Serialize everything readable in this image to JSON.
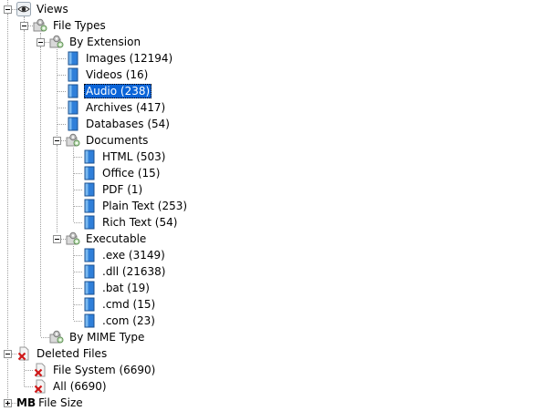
{
  "tree": {
    "nodes": [
      {
        "id": "views",
        "label": "Views",
        "icon": "eye-icon",
        "expanded": true
      },
      {
        "id": "file-types",
        "label": "File Types",
        "icon": "folder-gears-icon",
        "expanded": true
      },
      {
        "id": "by-extension",
        "label": "By Extension",
        "icon": "folder-gears-icon",
        "expanded": true
      },
      {
        "id": "images",
        "label": "Images (12194)",
        "icon": "file-icon"
      },
      {
        "id": "videos",
        "label": "Videos (16)",
        "icon": "file-icon"
      },
      {
        "id": "audio",
        "label": "Audio (238)",
        "icon": "file-icon",
        "selected": true
      },
      {
        "id": "archives",
        "label": "Archives (417)",
        "icon": "file-icon"
      },
      {
        "id": "databases",
        "label": "Databases (54)",
        "icon": "file-icon"
      },
      {
        "id": "documents",
        "label": "Documents",
        "icon": "folder-gears-icon",
        "expanded": true
      },
      {
        "id": "html",
        "label": "HTML (503)",
        "icon": "file-icon"
      },
      {
        "id": "office",
        "label": "Office (15)",
        "icon": "file-icon"
      },
      {
        "id": "pdf",
        "label": "PDF (1)",
        "icon": "file-icon"
      },
      {
        "id": "plain-text",
        "label": "Plain Text (253)",
        "icon": "file-icon"
      },
      {
        "id": "rich-text",
        "label": "Rich Text (54)",
        "icon": "file-icon"
      },
      {
        "id": "executable",
        "label": "Executable",
        "icon": "folder-gears-icon",
        "expanded": true
      },
      {
        "id": "exe",
        "label": ".exe (3149)",
        "icon": "file-icon"
      },
      {
        "id": "dll",
        "label": ".dll (21638)",
        "icon": "file-icon"
      },
      {
        "id": "bat",
        "label": ".bat (19)",
        "icon": "file-icon"
      },
      {
        "id": "cmd",
        "label": ".cmd (15)",
        "icon": "file-icon"
      },
      {
        "id": "com",
        "label": ".com (23)",
        "icon": "file-icon"
      },
      {
        "id": "by-mime-type",
        "label": "By MIME Type",
        "icon": "folder-gears-icon"
      },
      {
        "id": "deleted-files",
        "label": "Deleted Files",
        "icon": "deleted-file-icon",
        "expanded": true
      },
      {
        "id": "file-system",
        "label": "File System (6690)",
        "icon": "deleted-file-icon"
      },
      {
        "id": "all",
        "label": "All (6690)",
        "icon": "deleted-file-icon"
      },
      {
        "id": "file-size",
        "label": "File Size",
        "icon": "mb-icon",
        "icon_text": "MB",
        "expanded": false
      }
    ]
  }
}
